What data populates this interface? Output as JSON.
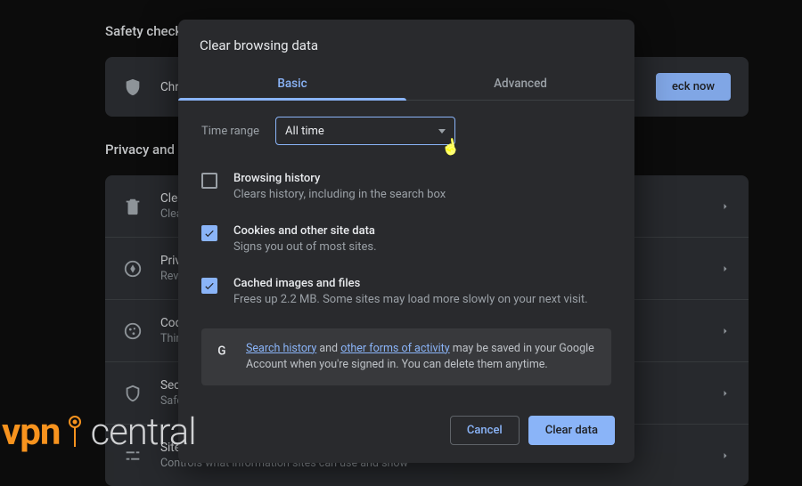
{
  "background": {
    "safety_check_heading": "Safety check",
    "safety_row_title": "Chrome",
    "check_now_label": "eck now",
    "privacy_heading": "Privacy and security",
    "rows": [
      {
        "title": "Clear browsing data",
        "sub": "Clear history, cookies, cache and more"
      },
      {
        "title": "Privacy guide",
        "sub": "Review key privacy and security controls"
      },
      {
        "title": "Cookies and other site data",
        "sub": "Third-party cookies are blocked in Incognito mode"
      },
      {
        "title": "Security",
        "sub": "Safe Browsing (protection from dangerous sites) and other security settings"
      },
      {
        "title": "Site settings",
        "sub": "Controls what information sites can use and show"
      }
    ]
  },
  "dialog": {
    "title": "Clear browsing data",
    "tabs": {
      "basic": "Basic",
      "advanced": "Advanced"
    },
    "time_range_label": "Time range",
    "time_range_value": "All time",
    "options": [
      {
        "title": "Browsing history",
        "desc": "Clears history, including in the search box",
        "checked": false
      },
      {
        "title": "Cookies and other site data",
        "desc": "Signs you out of most sites.",
        "checked": true
      },
      {
        "title": "Cached images and files",
        "desc": "Frees up 2.2 MB. Some sites may load more slowly on your next visit.",
        "checked": true
      }
    ],
    "info": {
      "link1": "Search history",
      "mid1": " and ",
      "link2": "other forms of activity",
      "rest": " may be saved in your Google Account when you're signed in. You can delete them anytime."
    },
    "cancel_label": "Cancel",
    "clear_label": "Clear data"
  },
  "watermark": {
    "vpn": "vpn",
    "central": "central"
  }
}
